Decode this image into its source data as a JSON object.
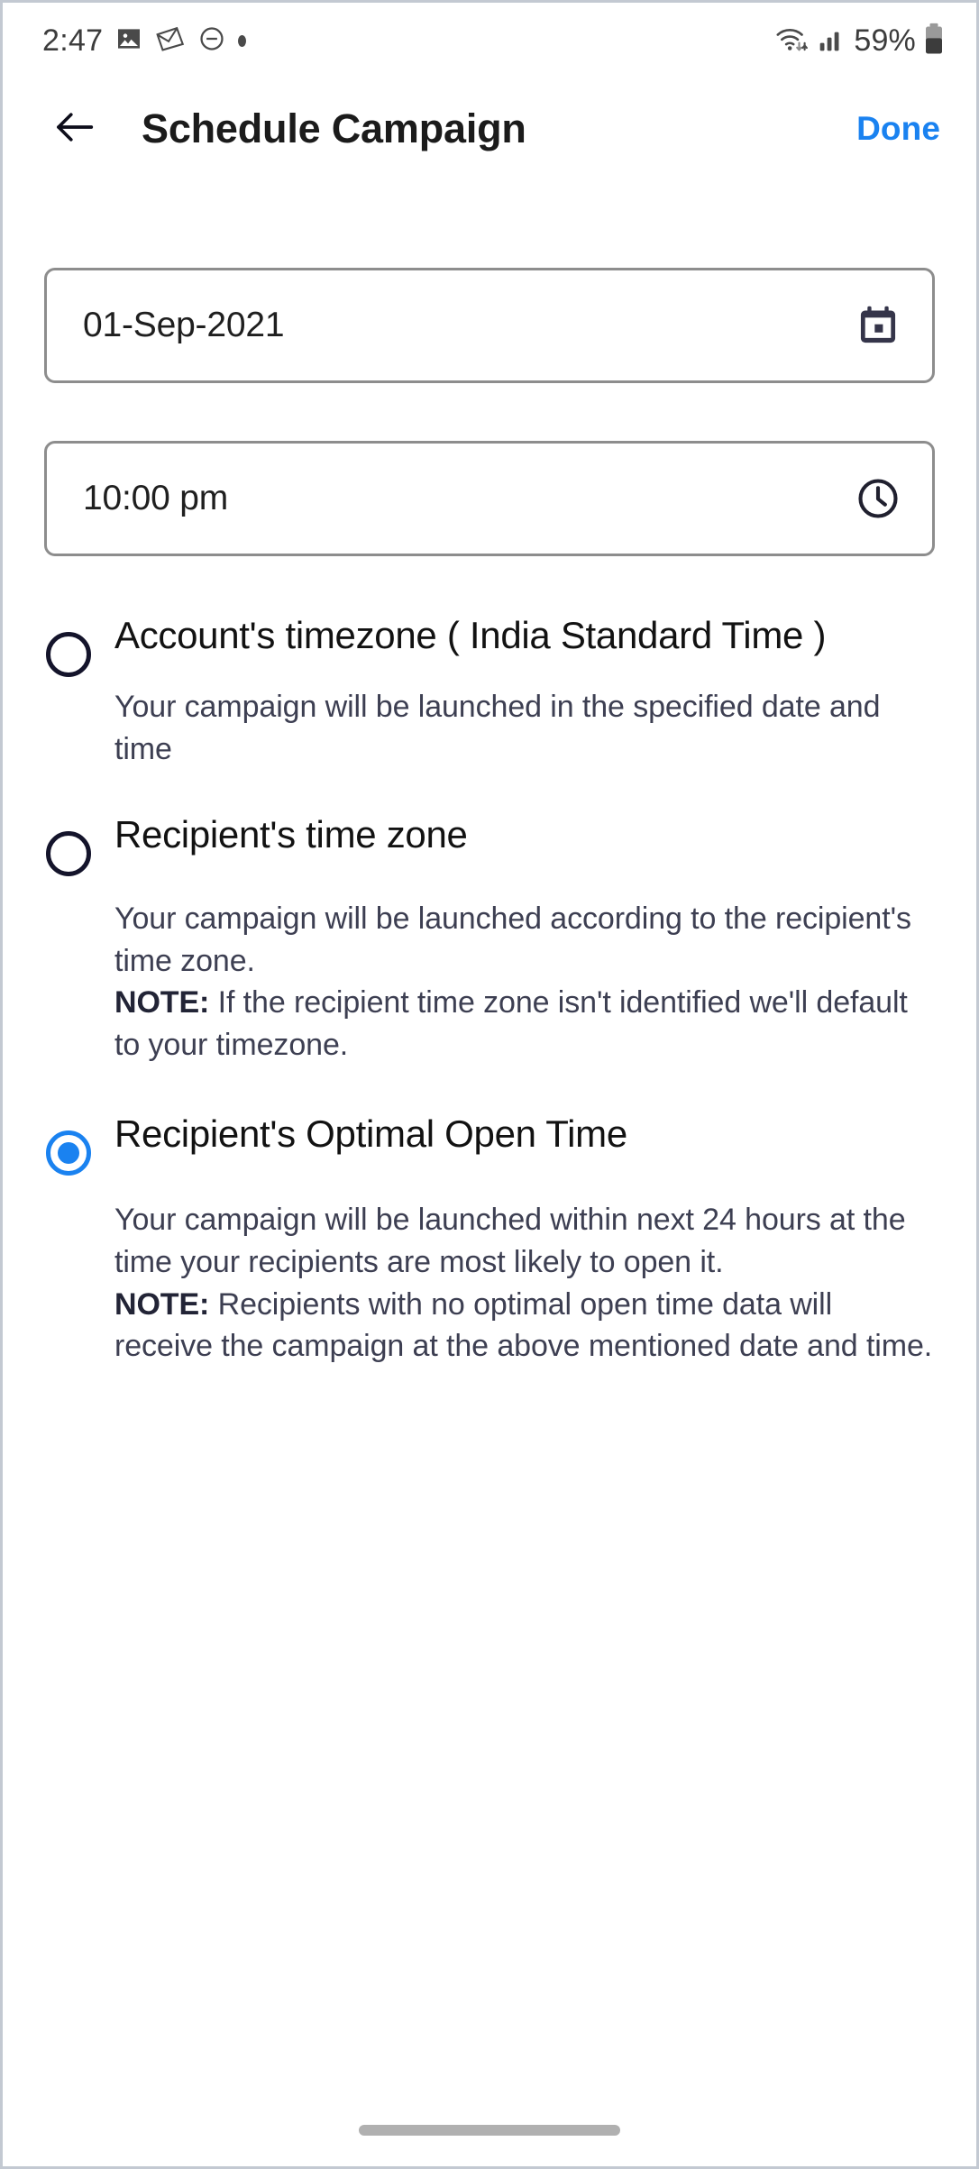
{
  "status_bar": {
    "time": "2:47",
    "battery_percent": "59%",
    "icons": [
      "image-icon",
      "mail-icon",
      "do-not-disturb-icon",
      "dot-icon",
      "wifi-icon",
      "cellular-signal-icon",
      "battery-icon"
    ]
  },
  "app_bar": {
    "back_label": "back-arrow",
    "title": "Schedule Campaign",
    "done_label": "Done",
    "accent_color": "#1a82f0"
  },
  "form": {
    "date": {
      "value": "01-Sep-2021",
      "icon": "calendar-icon"
    },
    "time": {
      "value": "10:00 pm",
      "icon": "clock-icon"
    }
  },
  "options": [
    {
      "label": "Account's timezone ( India Standard Time )",
      "selected": false,
      "desc": "Your campaign will be launched in the specified date and time",
      "note_label": "",
      "note": ""
    },
    {
      "label": "Recipient's time zone",
      "selected": false,
      "desc": "Your campaign will be launched according to the recipient's time zone.",
      "note_label": "NOTE:",
      "note": " If the recipient time zone isn't identified we'll default to your timezone."
    },
    {
      "label": "Recipient's Optimal Open Time",
      "selected": true,
      "desc": "Your campaign will be launched within next 24 hours at the time your recipients are most likely to open it.",
      "note_label": "NOTE:",
      "note": " Recipients with no optimal open time data will receive the campaign at the above mentioned date and time."
    }
  ],
  "navigation": {
    "home_indicator": "home-indicator"
  }
}
